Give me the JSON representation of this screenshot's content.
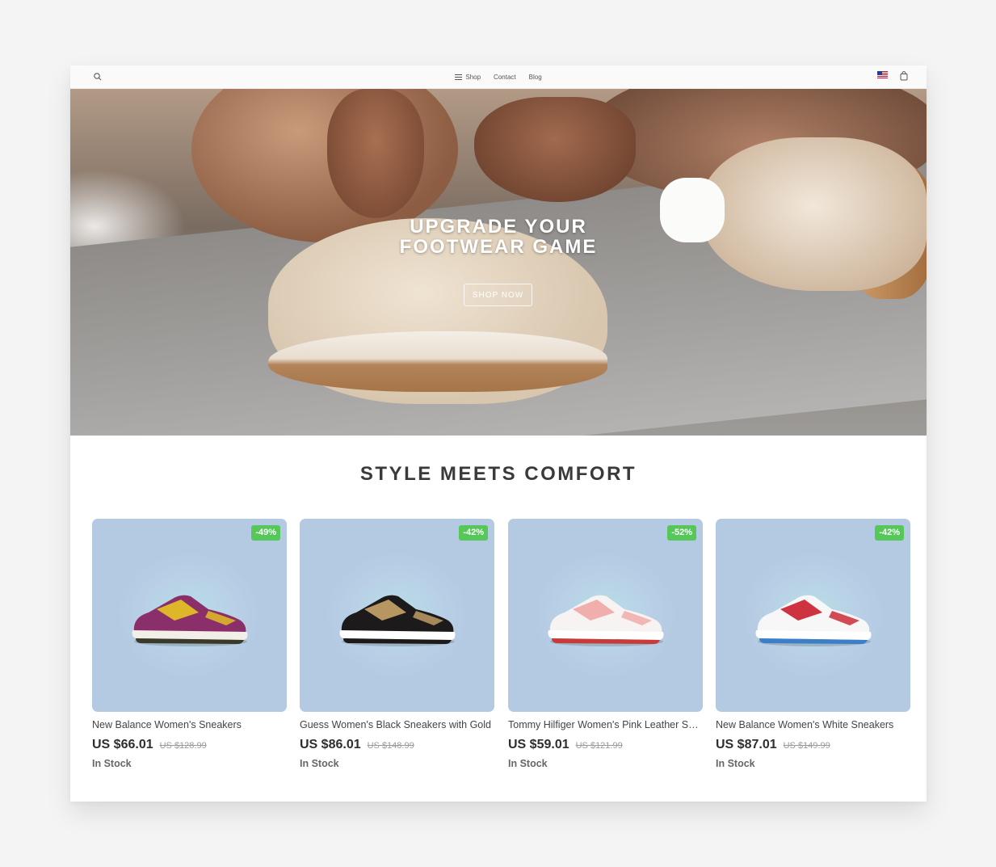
{
  "header": {
    "nav": [
      {
        "label": "Shop",
        "icon": "menu-icon"
      },
      {
        "label": "Contact"
      },
      {
        "label": "Blog"
      }
    ],
    "icons": [
      "search-icon",
      "us-flag-icon",
      "shopping-bag-icon"
    ]
  },
  "hero": {
    "title_line1": "UPGRADE YOUR",
    "title_line2": "FOOTWEAR GAME",
    "cta": "SHOP NOW"
  },
  "section": {
    "title": "STYLE MEETS COMFORT"
  },
  "products": [
    {
      "name": "New Balance Women's Sneakers",
      "price": "US $66.01",
      "old_price": "US $128.99",
      "badge": "-49%",
      "stock": "In Stock",
      "colors": {
        "upper": "#8b2f6a",
        "accent": "#e6c522",
        "sole": "#f2efe9",
        "outsole": "#3a3a2a"
      }
    },
    {
      "name": "Guess Women's Black Sneakers with Gold",
      "price": "US $86.01",
      "old_price": "US $148.99",
      "badge": "-42%",
      "stock": "In Stock",
      "colors": {
        "upper": "#1c1a1a",
        "accent": "#c9a46a",
        "sole": "#ffffff",
        "outsole": "#1c1a1a"
      }
    },
    {
      "name": "Tommy Hilfiger Women's Pink Leather Sneakers",
      "price": "US $59.01",
      "old_price": "US $121.99",
      "badge": "-52%",
      "stock": "In Stock",
      "colors": {
        "upper": "#f6f3f2",
        "accent": "#f0a7a4",
        "sole": "#ffffff",
        "outsole": "#c93a3a"
      }
    },
    {
      "name": "New Balance Women's White Sneakers",
      "price": "US $87.01",
      "old_price": "US $149.99",
      "badge": "-42%",
      "stock": "In Stock",
      "colors": {
        "upper": "#f7f7f7",
        "accent": "#c81e2b",
        "sole": "#ffffff",
        "outsole": "#3c7fc9"
      }
    }
  ],
  "colors": {
    "badge": "#56c759",
    "page_bg": "#f4f4f4"
  }
}
